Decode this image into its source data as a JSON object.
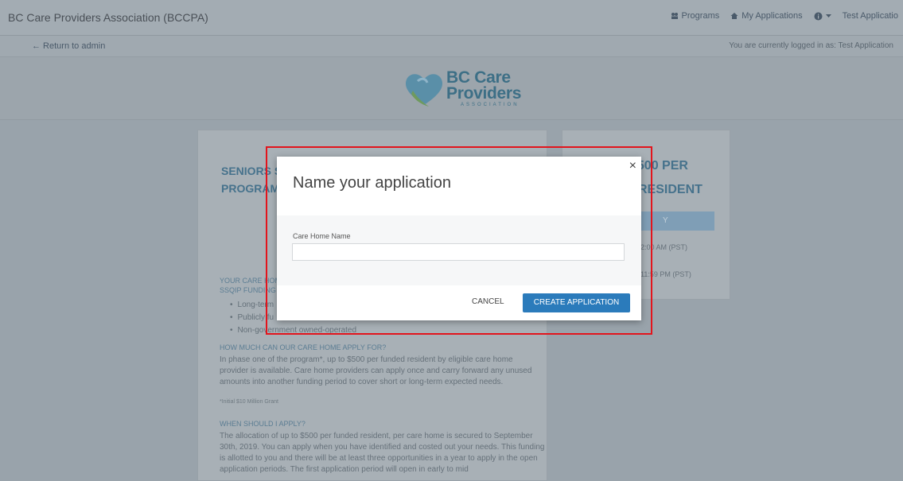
{
  "app": {
    "brand": "BC Care Providers Association (BCCPA)",
    "nav": {
      "programs": "Programs",
      "my_applications": "My Applications",
      "user": "Test Applicatio"
    },
    "return_link": "← Return to admin",
    "logged_in": "You are currently logged in as: Test Application"
  },
  "logo": {
    "line1": "BC Care",
    "line2": "Providers",
    "line3": "ASSOCIATION"
  },
  "page": {
    "program_title_1": "SENIORS S",
    "program_title_2": "PROGRAM",
    "care_question_1": "YOUR CARE HOME",
    "care_question_2": "SSQIP FUNDING",
    "bullets": [
      "Long-term",
      "Publicly fu",
      "Non-government owned-operated"
    ],
    "how_heading": "HOW MUCH CAN OUR CARE HOME APPLY FOR?",
    "how_text": "In phase one of the program*, up to $500 per funded resident by eligible care home provider is available. Care home providers can apply once and carry forward any unused amounts into another funding period to cover short or long-term expected needs.",
    "note": "*Initial $10 Million Grant",
    "when_heading": "WHEN SHOULD I APPLY?",
    "when_text": "The allocation of up to $500 per funded resident, per care home is secured to September 30th, 2019. You can apply when you have identified and costed out your needs. This funding is allotted to you and there will be at least three opportunities in a year to apply in the open application periods. The first application period will open in early to mid"
  },
  "side": {
    "price_line1": "$500 PER",
    "price_line2": "RESIDENT",
    "apply": "Y",
    "date1": "2:00 AM (PST)",
    "date2": "11:59 PM (PST)"
  },
  "modal": {
    "title": "Name your application",
    "field_label": "Care Home Name",
    "field_value": "",
    "field_placeholder": "",
    "cancel": "CANCEL",
    "create": "CREATE APPLICATION",
    "close": "×"
  }
}
